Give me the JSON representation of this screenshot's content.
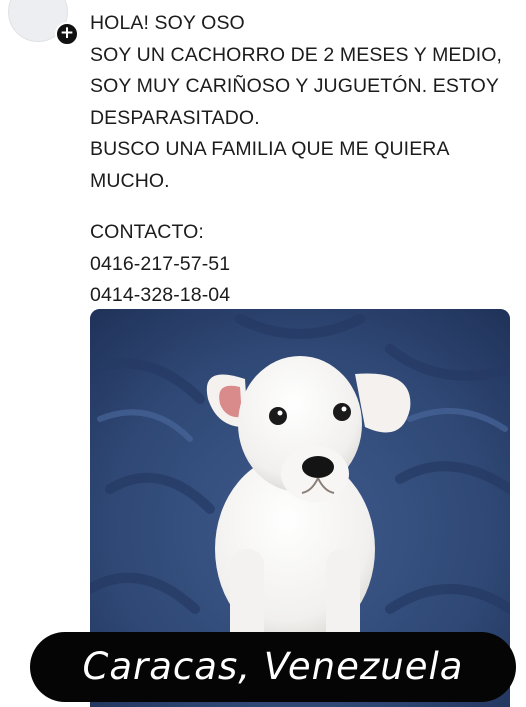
{
  "post": {
    "lines": [
      "HOLA! SOY OSO",
      "SOY UN CACHORRO DE 2 MESES Y MEDIO,",
      "SOY MUY CARIÑOSO Y JUGUETÓN. ESTOY",
      "DESPARASITADO.",
      "BUSCO UNA FAMILIA QUE ME QUIERA",
      "MUCHO."
    ],
    "contact_label": "CONTACTO:",
    "phones": [
      "0416-217-57-51",
      "0414-328-18-04"
    ]
  },
  "badge": {
    "symbol": "+"
  },
  "photo": {
    "caption": "Caracas, Venezuela"
  },
  "colors": {
    "text": "#1c1c1c",
    "blanket": "#2d4470",
    "caption_bg": "#050505",
    "caption_text": "#ffffff"
  }
}
